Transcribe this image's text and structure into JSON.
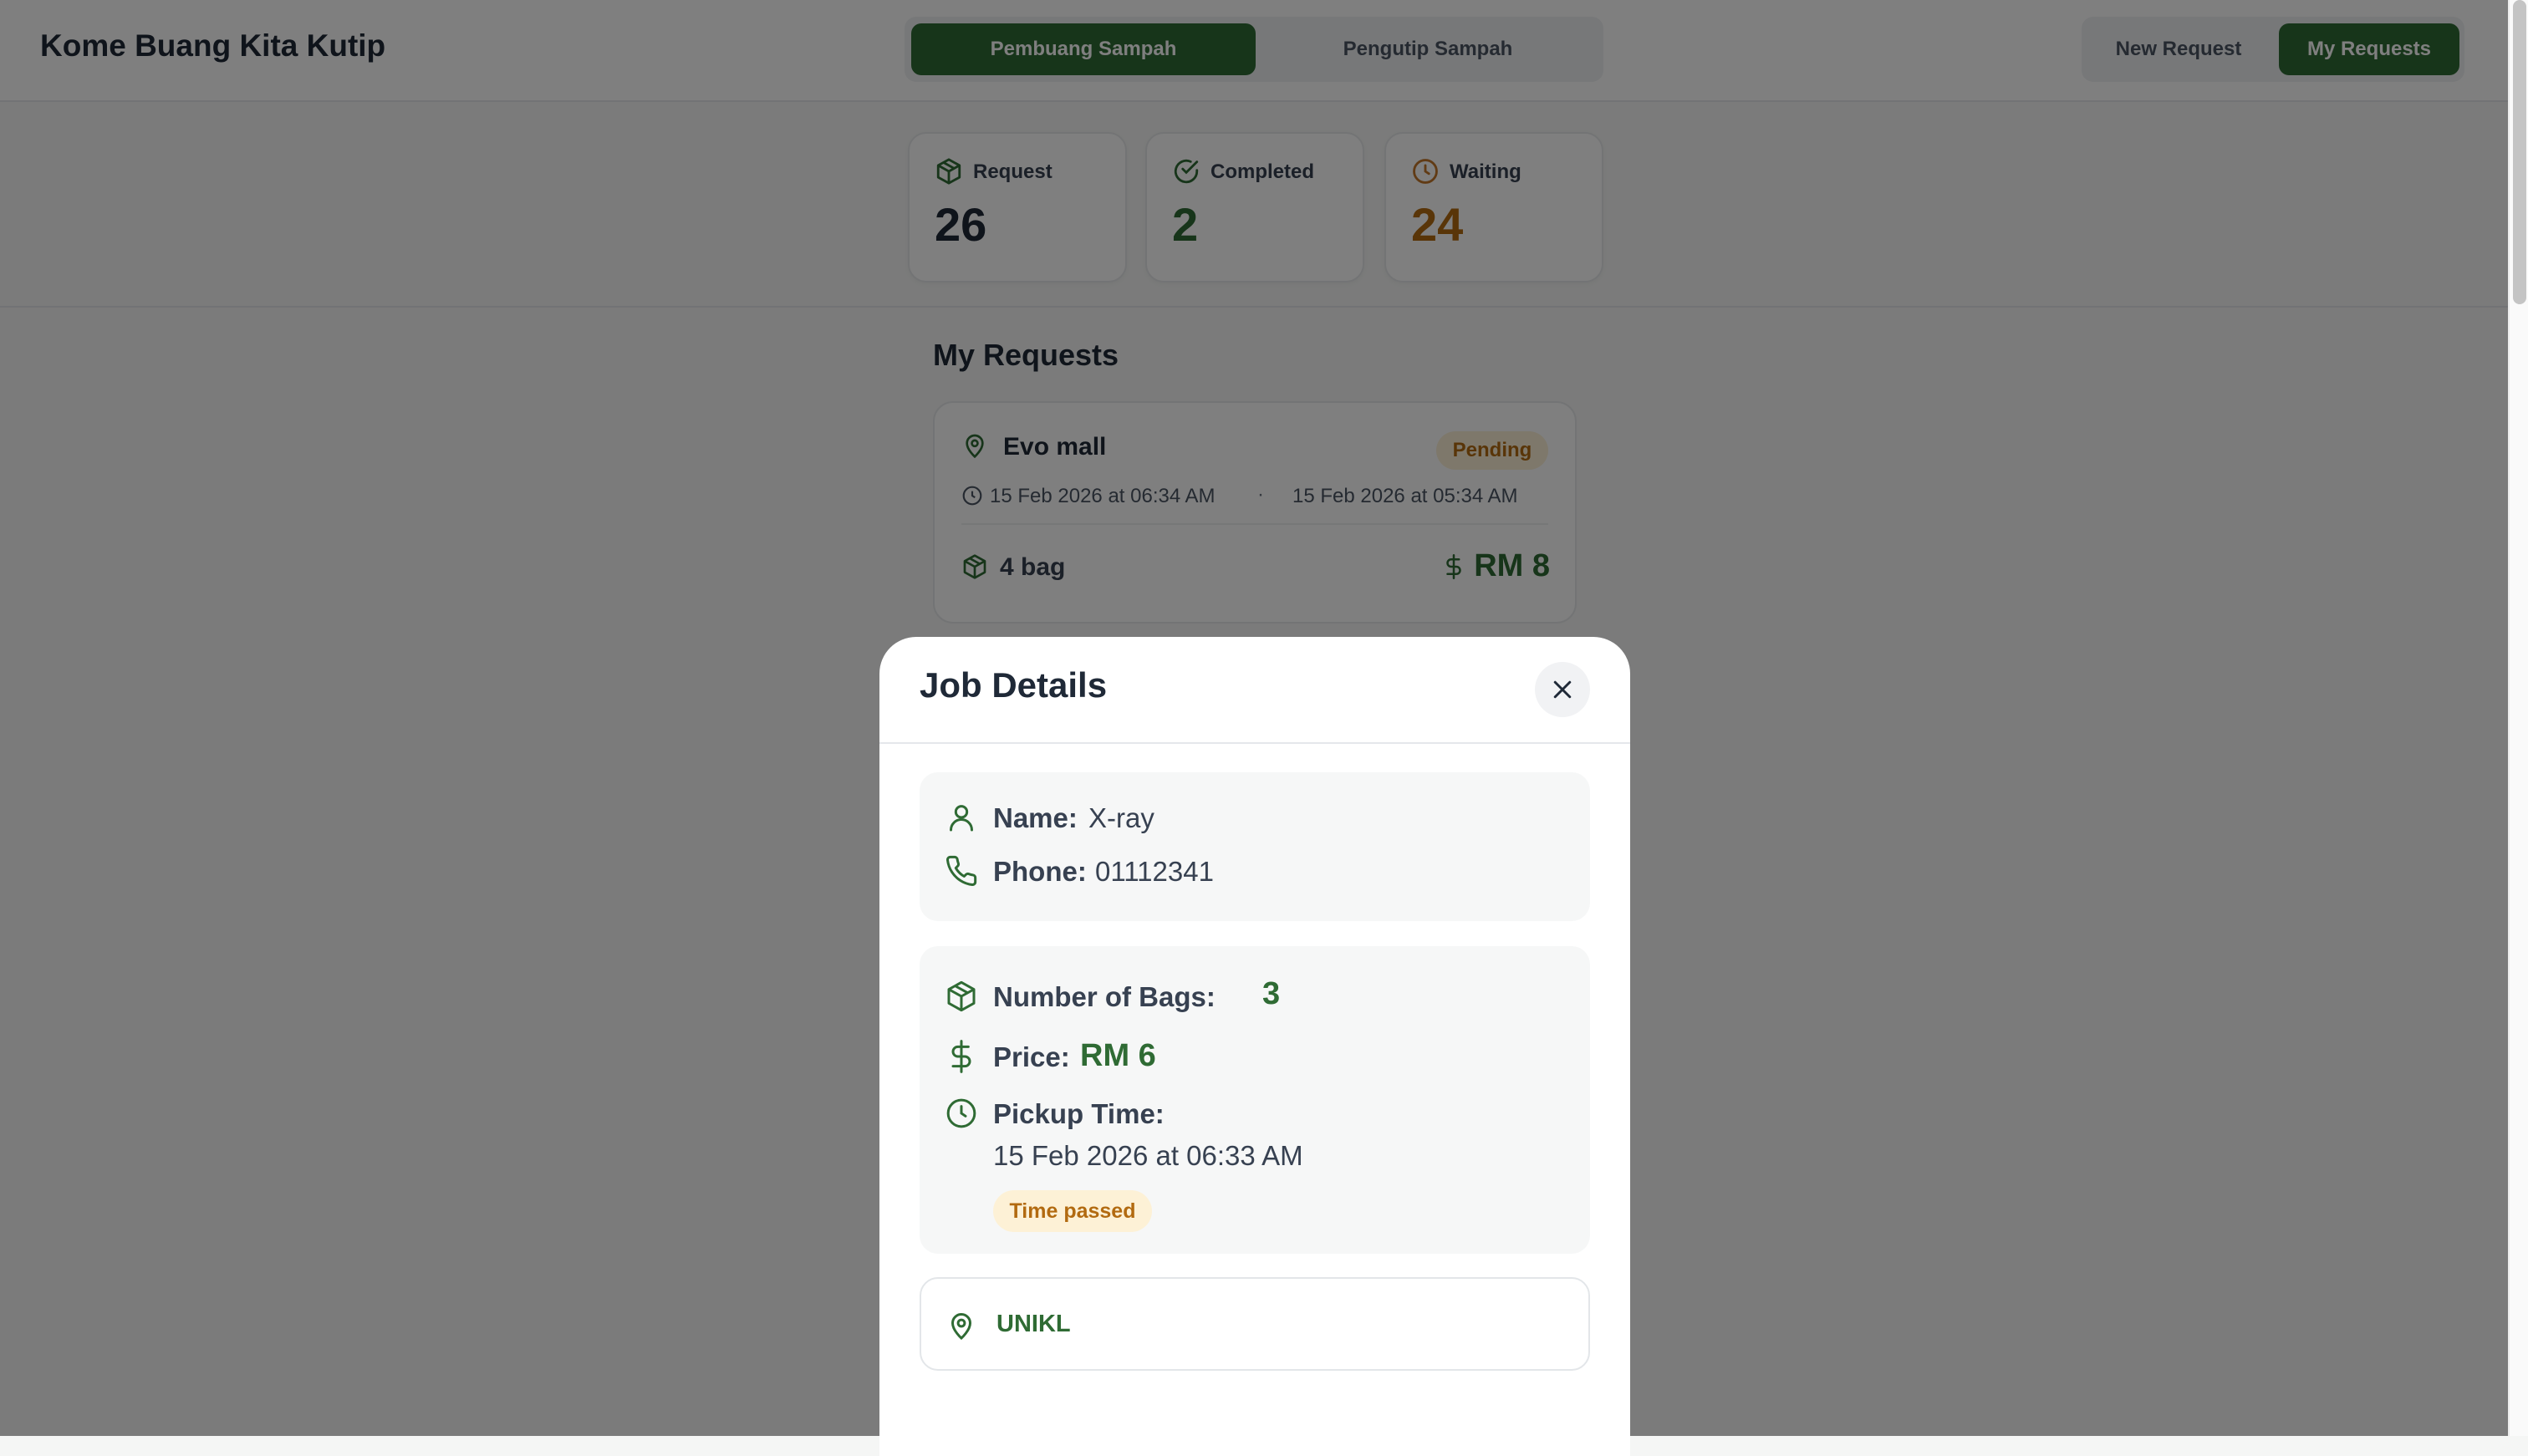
{
  "app": {
    "title": "Kome Buang Kita Kutip"
  },
  "role_toggle": {
    "options": [
      "Pembuang Sampah",
      "Pengutip Sampah"
    ],
    "active": "Pembuang Sampah"
  },
  "nav": {
    "new_request": "New Request",
    "my_requests": "My Requests",
    "active": "My Requests"
  },
  "stats": [
    {
      "label": "Request",
      "value": "26",
      "color": "#1f2937",
      "icon": "package-icon"
    },
    {
      "label": "Completed",
      "value": "2",
      "color": "#2f6b34",
      "icon": "check-circle-icon"
    },
    {
      "label": "Waiting",
      "value": "24",
      "color": "#b26a10",
      "icon": "clock-icon"
    }
  ],
  "section_title": "My Requests",
  "requests": [
    {
      "location": "Evo mall",
      "status": "Pending",
      "pickup_time": "15 Feb 2026 at 06:34 AM",
      "separator": "·",
      "created_time": "15 Feb 2026 at 05:34 AM",
      "bags": "4 bag",
      "price": "RM 8"
    }
  ],
  "modal": {
    "title": "Job Details",
    "contact": {
      "name_label": "Name:",
      "name_value": "X-ray",
      "phone_label": "Phone:",
      "phone_value": "01112341"
    },
    "job": {
      "bags_label": "Number of Bags:",
      "bags_value": "3",
      "price_label": "Price:",
      "price_value": "RM 6",
      "pickup_label": "Pickup Time:",
      "pickup_value": "15 Feb 2026 at 06:33 AM",
      "time_badge": "Time passed"
    },
    "location": "UNIKL"
  },
  "colors": {
    "brand_green": "#2f6b34",
    "pending_bg": "#fdf1d6",
    "pending_text": "#b26a10"
  }
}
